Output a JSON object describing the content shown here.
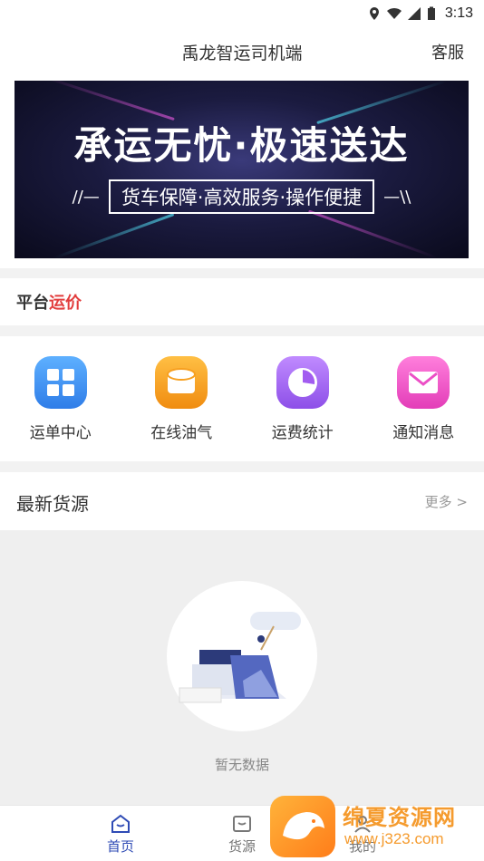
{
  "status_bar": {
    "time": "3:13"
  },
  "header": {
    "title": "禹龙智运司机端",
    "service": "客服"
  },
  "banner": {
    "main_text": "承运无忧·极速送达",
    "sub_text": "货车保障·高效服务·操作便捷",
    "left_deco": "//—",
    "right_deco": "—\\\\"
  },
  "platform_rate": {
    "part1": "平台",
    "part2": "运价",
    "accent": "#e23d3d"
  },
  "grid": [
    {
      "label": "运单中心",
      "icon": "grid-icon",
      "color": "#3d8ef0"
    },
    {
      "label": "在线油气",
      "icon": "oil-drum-icon",
      "color": "#f7a020"
    },
    {
      "label": "运费统计",
      "icon": "pie-chart-icon",
      "color": "#a25cf0"
    },
    {
      "label": "通知消息",
      "icon": "mail-icon",
      "color": "#ec4fc6"
    }
  ],
  "latest": {
    "title": "最新货源",
    "more": "更多 >"
  },
  "empty": {
    "text": "暂无数据"
  },
  "bottom_nav": [
    {
      "label": "首页",
      "icon": "home-icon",
      "active": true
    },
    {
      "label": "货源",
      "icon": "goods-icon",
      "active": false
    },
    {
      "label": "我的",
      "icon": "user-icon",
      "active": false
    }
  ],
  "watermark": {
    "text": "绵夏资源网",
    "url": "www.j323.com"
  },
  "colors": {
    "active": "#2f4bb5",
    "inactive": "#777777"
  }
}
